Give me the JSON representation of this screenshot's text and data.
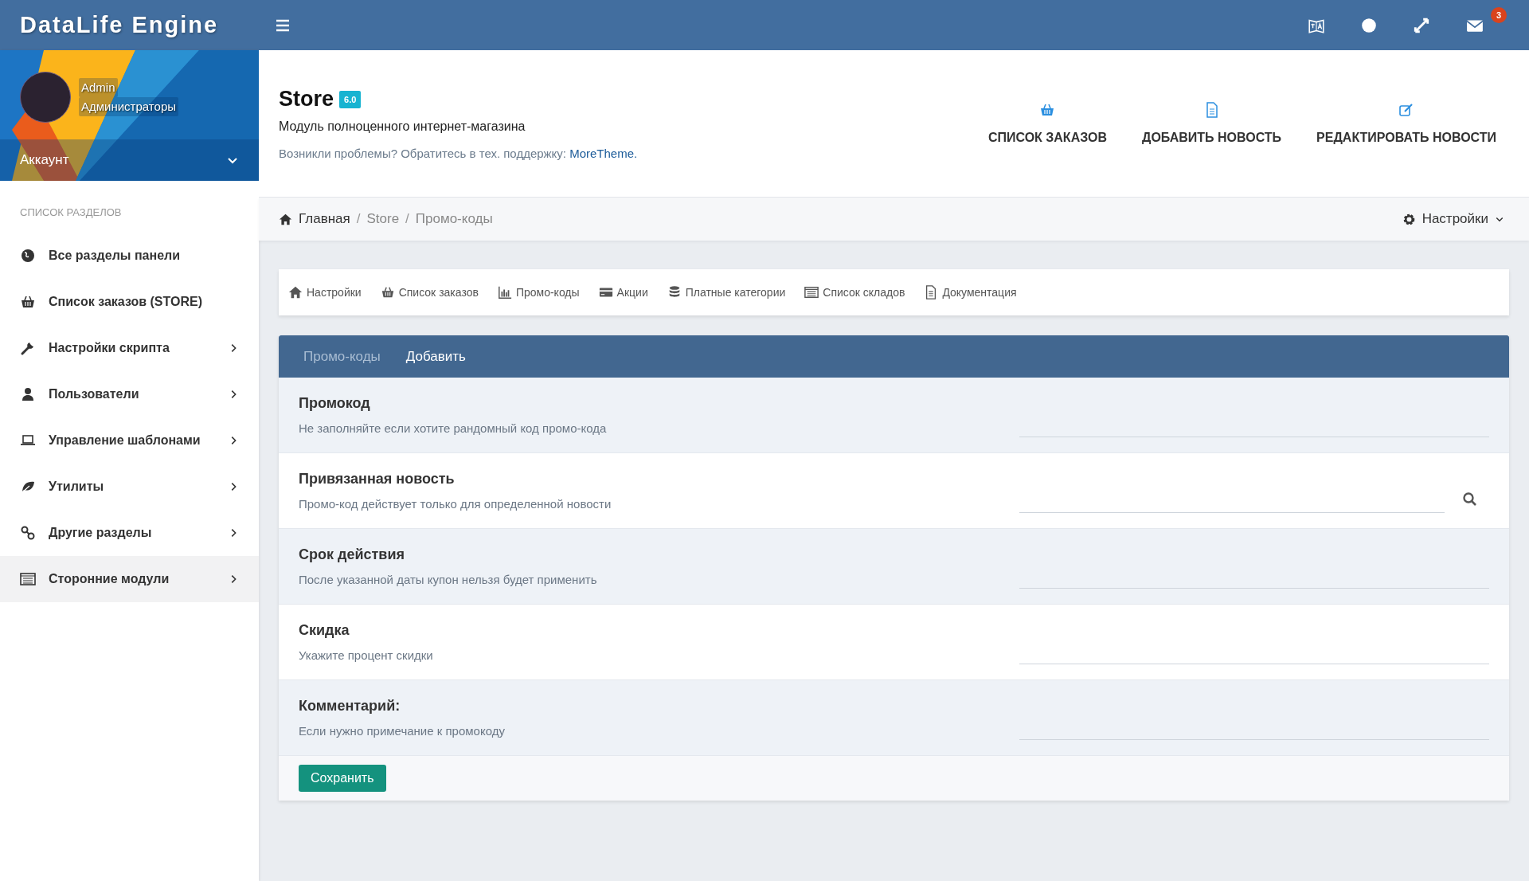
{
  "topbar": {
    "logo": "DataLife Engine",
    "notifications": "3"
  },
  "profile": {
    "name": "Admin",
    "group": "Администраторы",
    "account": "Аккаунт"
  },
  "sidebar": {
    "heading": "СПИСОК РАЗДЕЛОВ",
    "items": [
      {
        "label": "Все разделы панели",
        "has_submenu": false,
        "selected": false
      },
      {
        "label": "Список заказов (STORE)",
        "has_submenu": false,
        "selected": false
      },
      {
        "label": "Настройки скрипта",
        "has_submenu": true,
        "selected": false
      },
      {
        "label": "Пользователи",
        "has_submenu": true,
        "selected": false
      },
      {
        "label": "Управление шаблонами",
        "has_submenu": true,
        "selected": false
      },
      {
        "label": "Утилиты",
        "has_submenu": true,
        "selected": false
      },
      {
        "label": "Другие разделы",
        "has_submenu": true,
        "selected": false
      },
      {
        "label": "Сторонние модули",
        "has_submenu": true,
        "selected": true
      }
    ]
  },
  "header": {
    "title": "Store",
    "version": "6.0",
    "subtitle": "Модуль полноценного интернет-магазина",
    "support_text": "Возникли проблемы? Обратитесь в тех. поддержку:",
    "support_link": "MoreTheme.",
    "actions": [
      "СПИСОК ЗАКАЗОВ",
      "ДОБАВИТЬ НОВОСТЬ",
      "РЕДАКТИРОВАТЬ НОВОСТИ"
    ]
  },
  "breadcrumb": {
    "separator": "/",
    "items": [
      "Главная",
      "Store",
      "Промо-коды"
    ],
    "settings": "Настройки"
  },
  "toolbar": [
    "Настройки",
    "Список заказов",
    "Промо-коды",
    "Акции",
    "Платные категории",
    "Список складов",
    "Документация"
  ],
  "panel": {
    "tabs": [
      {
        "label": "Промо-коды",
        "selected": false
      },
      {
        "label": "Добавить",
        "selected": true
      }
    ],
    "rows": [
      {
        "title": "Промокод",
        "hint": "Не заполняйте если хотите рандомный код промо-кода",
        "kind": "text"
      },
      {
        "title": "Привязанная новость",
        "hint": "Промо-код действует только для определенной новости",
        "kind": "search"
      },
      {
        "title": "Срок действия",
        "hint": "После указанной даты купон нельзя будет применить",
        "kind": "text"
      },
      {
        "title": "Скидка",
        "hint": "Укажите процент скидки",
        "kind": "text"
      },
      {
        "title": "Комментарий:",
        "hint": "Если нужно примечание к промокоду",
        "kind": "text"
      }
    ],
    "save": "Сохранить"
  }
}
